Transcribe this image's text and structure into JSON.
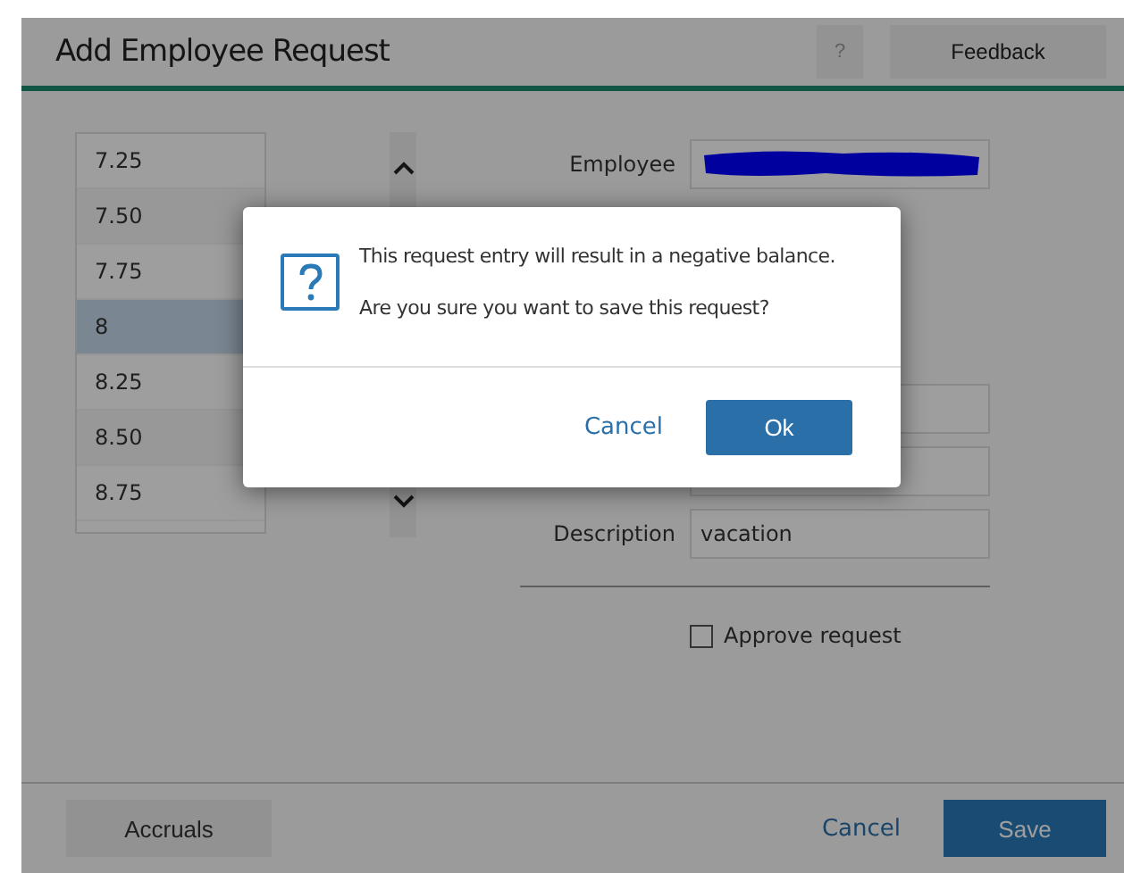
{
  "window": {
    "title": "Add Employee Request"
  },
  "header_buttons": [
    {
      "kind": "help",
      "label": "?"
    },
    {
      "kind": "feedback",
      "label": "Feedback"
    }
  ],
  "hours_list": {
    "items": [
      {
        "label": "7.25",
        "selected": false
      },
      {
        "label": "7.50",
        "selected": false
      },
      {
        "label": "7.75",
        "selected": false
      },
      {
        "label": "8",
        "selected": true
      },
      {
        "label": "8.25",
        "selected": false
      },
      {
        "label": "8.50",
        "selected": false
      },
      {
        "label": "8.75",
        "selected": false
      }
    ]
  },
  "form": {
    "fields": [
      {
        "kind": "redacted",
        "label": "Employee"
      },
      {
        "kind": "covered"
      },
      {
        "kind": "covered"
      },
      {
        "kind": "text",
        "label": "Description",
        "value": "vacation"
      }
    ],
    "approve": {
      "label": "Approve request",
      "checked": false
    }
  },
  "footer": {
    "left_button": "Accruals",
    "cancel": "Cancel",
    "save": "Save"
  },
  "dialog": {
    "message": "This request entry will result in a negative balance.",
    "question": "Are you sure you want to save this request?",
    "cancel": "Cancel",
    "ok": "Ok"
  }
}
